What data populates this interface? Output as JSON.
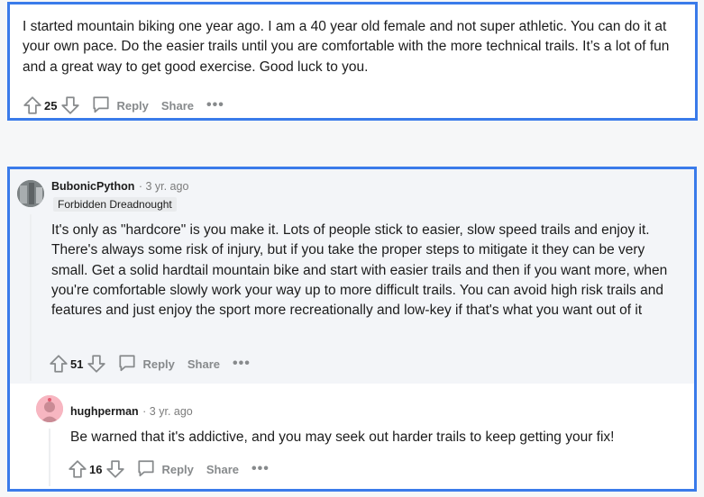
{
  "comment1": {
    "text": "I started mountain biking one year ago. I am a 40 year old female and not super athletic. You can do it at your own pace. Do the easier trails until you are comfortable with the more technical trails. It’s a lot of fun and a great way to get good exercise. Good luck to you.",
    "score": "25",
    "reply_label": "Reply",
    "share_label": "Share",
    "more_label": "•••"
  },
  "comment2": {
    "username": "BubonicPython",
    "time": "· 3 yr. ago",
    "flair": "Forbidden Dreadnought",
    "text": "It's only as \"hardcore\" is you make it. Lots of people stick to easier, slow speed trails and enjoy it. There's always some risk of injury, but if you take the proper steps to mitigate it they can be very small. Get a solid hardtail mountain bike and start with easier trails and then if you want more, when you're comfortable slowly work your way up to more difficult trails. You can avoid high risk trails and features and just enjoy the sport more recreationally and low-key if that's what you want out of it",
    "score": "51",
    "reply_label": "Reply",
    "share_label": "Share",
    "more_label": "•••"
  },
  "comment3": {
    "username": "hughperman",
    "time": "· 3 yr. ago",
    "text": "Be warned that it's addictive, and you may seek out harder trails to keep getting your fix!",
    "score": "16",
    "reply_label": "Reply",
    "share_label": "Share",
    "more_label": "•••"
  },
  "colors": {
    "highlight_border": "#3a7bea",
    "meta_gray": "#878a8c",
    "highlight_bg": "#f3f5f8"
  }
}
